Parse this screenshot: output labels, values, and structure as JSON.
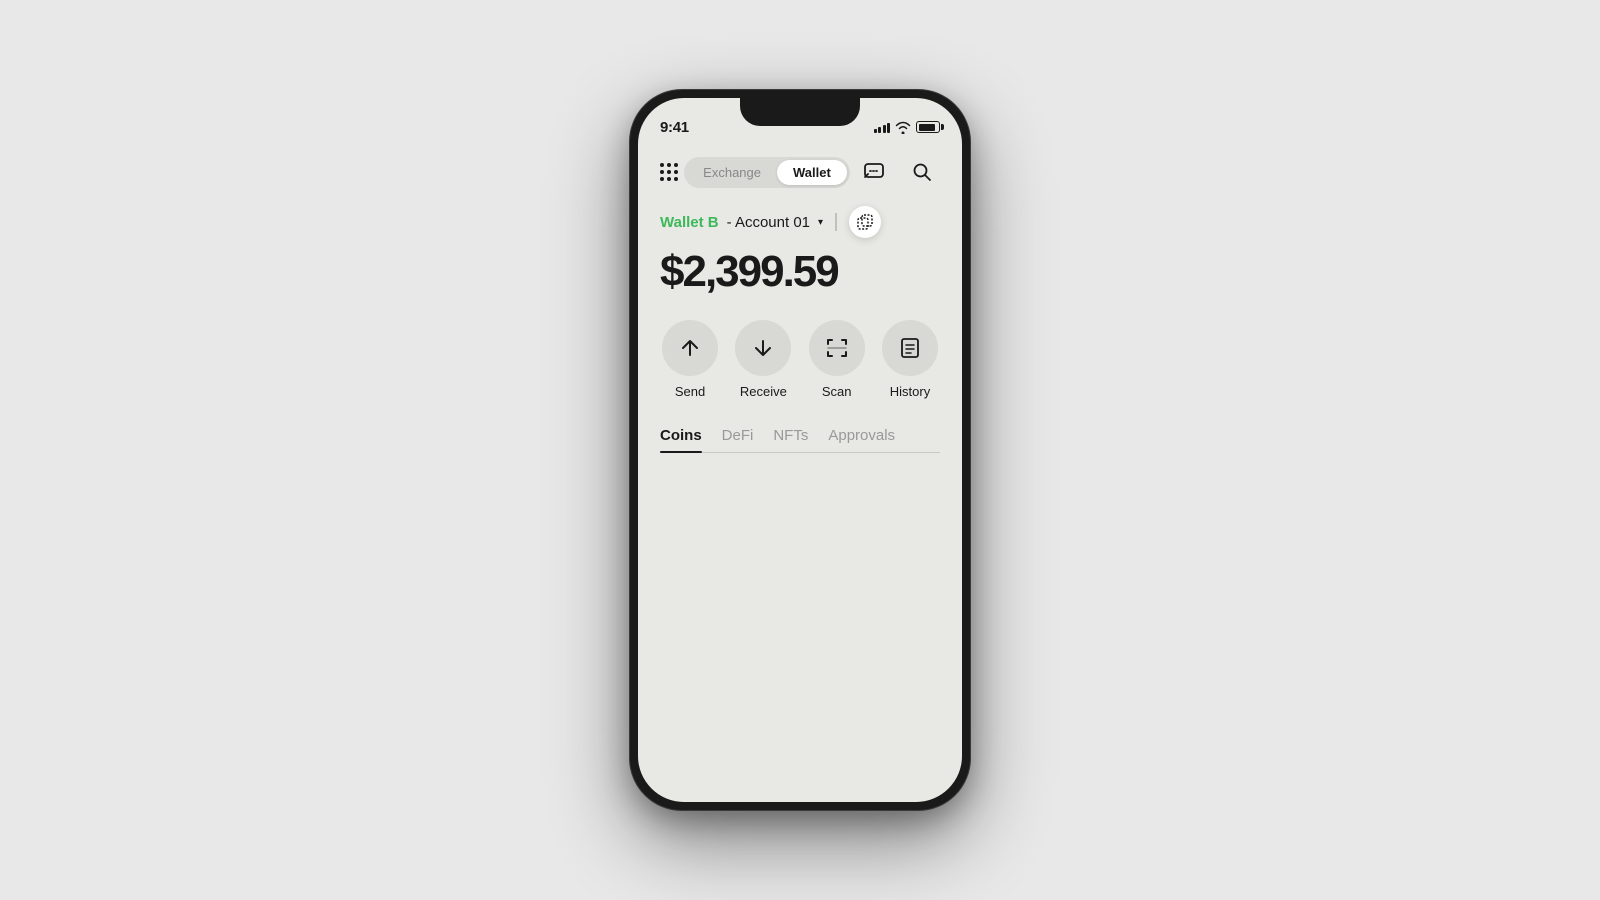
{
  "status": {
    "time": "9:41",
    "signal_bars": [
      4,
      6,
      8,
      10,
      12
    ],
    "wifi": "wifi",
    "battery": 85
  },
  "header": {
    "exchange_label": "Exchange",
    "wallet_label": "Wallet"
  },
  "wallet": {
    "name": "Wallet B",
    "account": "- Account 01",
    "balance": "$2,399.59"
  },
  "actions": [
    {
      "id": "send",
      "label": "Send",
      "icon": "arrow-up"
    },
    {
      "id": "receive",
      "label": "Receive",
      "icon": "arrow-down"
    },
    {
      "id": "scan",
      "label": "Scan",
      "icon": "scan"
    },
    {
      "id": "history",
      "label": "History",
      "icon": "list"
    }
  ],
  "tabs": [
    {
      "id": "coins",
      "label": "Coins",
      "active": true
    },
    {
      "id": "defi",
      "label": "DeFi",
      "active": false
    },
    {
      "id": "nfts",
      "label": "NFTs",
      "active": false
    },
    {
      "id": "approvals",
      "label": "Approvals",
      "active": false
    }
  ],
  "colors": {
    "accent_green": "#3db85a",
    "background": "#e8e8e4",
    "circle_bg": "#d8d8d4"
  }
}
